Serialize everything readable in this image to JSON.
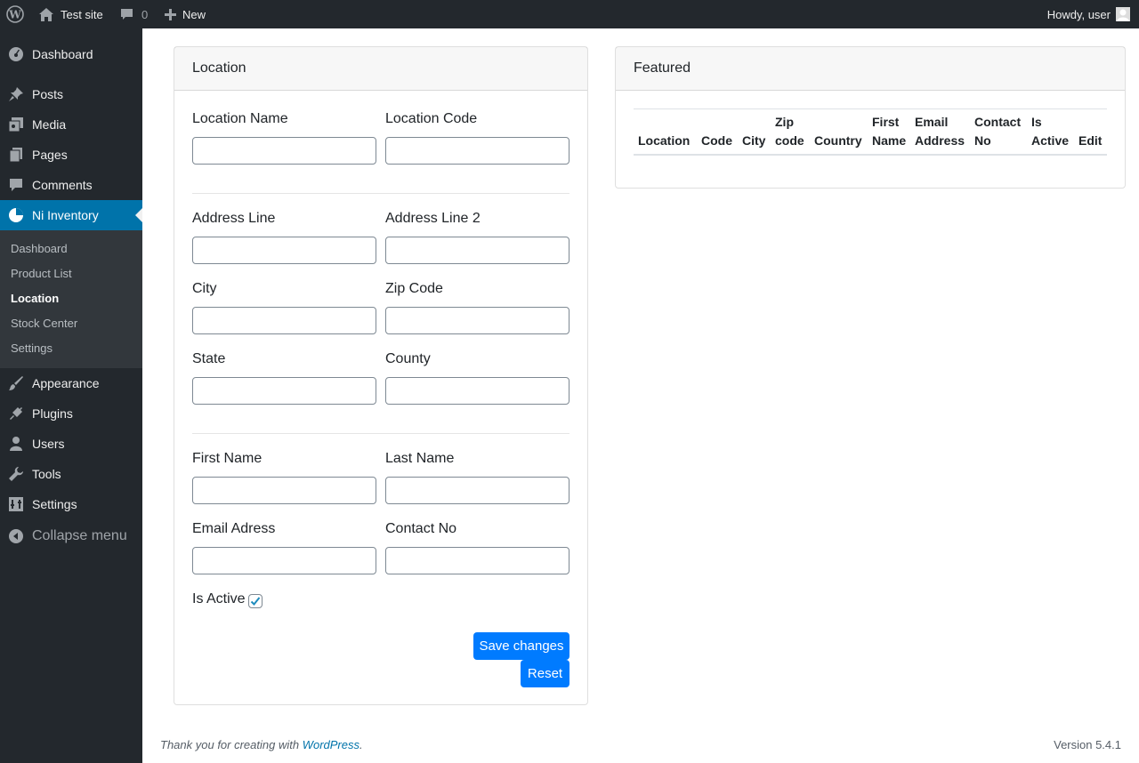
{
  "adminbar": {
    "site_name": "Test site",
    "comments_count": "0",
    "new_label": "New",
    "howdy": "Howdy, user"
  },
  "sidebar": {
    "items": [
      {
        "label": "Dashboard",
        "icon": "dashboard-icon"
      },
      {
        "label": "Posts",
        "icon": "pin-icon"
      },
      {
        "label": "Media",
        "icon": "media-icon"
      },
      {
        "label": "Pages",
        "icon": "pages-icon"
      },
      {
        "label": "Comments",
        "icon": "comment-icon"
      },
      {
        "label": "Ni Inventory",
        "icon": "pie-chart-icon"
      },
      {
        "label": "Appearance",
        "icon": "brush-icon"
      },
      {
        "label": "Plugins",
        "icon": "plug-icon"
      },
      {
        "label": "Users",
        "icon": "user-icon"
      },
      {
        "label": "Tools",
        "icon": "wrench-icon"
      },
      {
        "label": "Settings",
        "icon": "settings-icon"
      }
    ],
    "submenu": [
      "Dashboard",
      "Product List",
      "Location",
      "Stock Center",
      "Settings"
    ],
    "collapse_label": "Collapse menu"
  },
  "location_form": {
    "title": "Location",
    "fields": {
      "location_name": "Location Name",
      "location_code": "Location Code",
      "address_line": "Address Line",
      "address_line_2": "Address Line 2",
      "city": "City",
      "zip_code": "Zip Code",
      "state": "State",
      "county": "County",
      "first_name": "First Name",
      "last_name": "Last Name",
      "email": "Email Adress",
      "contact_no": "Contact No"
    },
    "is_active_label": "Is Active",
    "is_active": true,
    "save_label": "Save changes",
    "reset_label": "Reset"
  },
  "featured": {
    "title": "Featured",
    "columns": [
      [
        "",
        "Location"
      ],
      [
        "",
        "Code"
      ],
      [
        "",
        "City"
      ],
      [
        "Zip",
        "code"
      ],
      [
        "",
        "Country"
      ],
      [
        "First",
        "Name"
      ],
      [
        "Email",
        "Address"
      ],
      [
        "Contact",
        "No"
      ],
      [
        "Is",
        "Active"
      ],
      [
        "",
        "Edit"
      ]
    ]
  },
  "footer": {
    "thanks_prefix": "Thank you for creating with ",
    "wordpress_link": "WordPress",
    "thanks_suffix": ".",
    "version": "Version 5.4.1"
  },
  "colors": {
    "adminbar_bg": "#23282d",
    "accent": "#0073aa",
    "button": "#007bff"
  }
}
